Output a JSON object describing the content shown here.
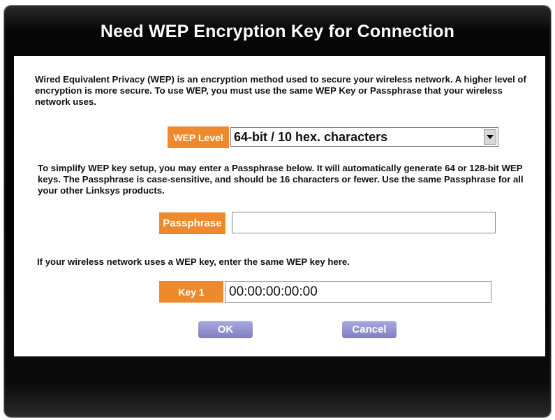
{
  "dialog": {
    "title": "Need WEP Encryption Key for Connection",
    "intro_text": "Wired Equivalent Privacy (WEP) is an encryption method used to secure your wireless network. A higher level of encryption is more secure.  To use WEP, you must use the same WEP Key or Passphrase that your wireless network uses.",
    "wep_level": {
      "label": "WEP Level",
      "selected": "64-bit / 10 hex. characters",
      "dropdown_icon": "chevron-down-icon"
    },
    "passphrase_text": "To simplify WEP key setup, you may enter a Passphrase below.  It will automatically generate 64 or 128-bit WEP keys.  The Passphrase is case-sensitive, and should be 16 characters or fewer. Use the same Passphrase for all your other Linksys products.",
    "passphrase": {
      "label": "Passphrase",
      "value": ""
    },
    "key_text": "If your wireless network uses a WEP key, enter the same WEP key here.",
    "key1": {
      "label": "Key 1",
      "value": "00:00:00:00:00"
    },
    "buttons": {
      "ok": "OK",
      "cancel": "Cancel"
    },
    "colors": {
      "label_orange": "#ee8a2c",
      "button_purple": "#8e8ed0",
      "frame_black": "#000000"
    }
  }
}
